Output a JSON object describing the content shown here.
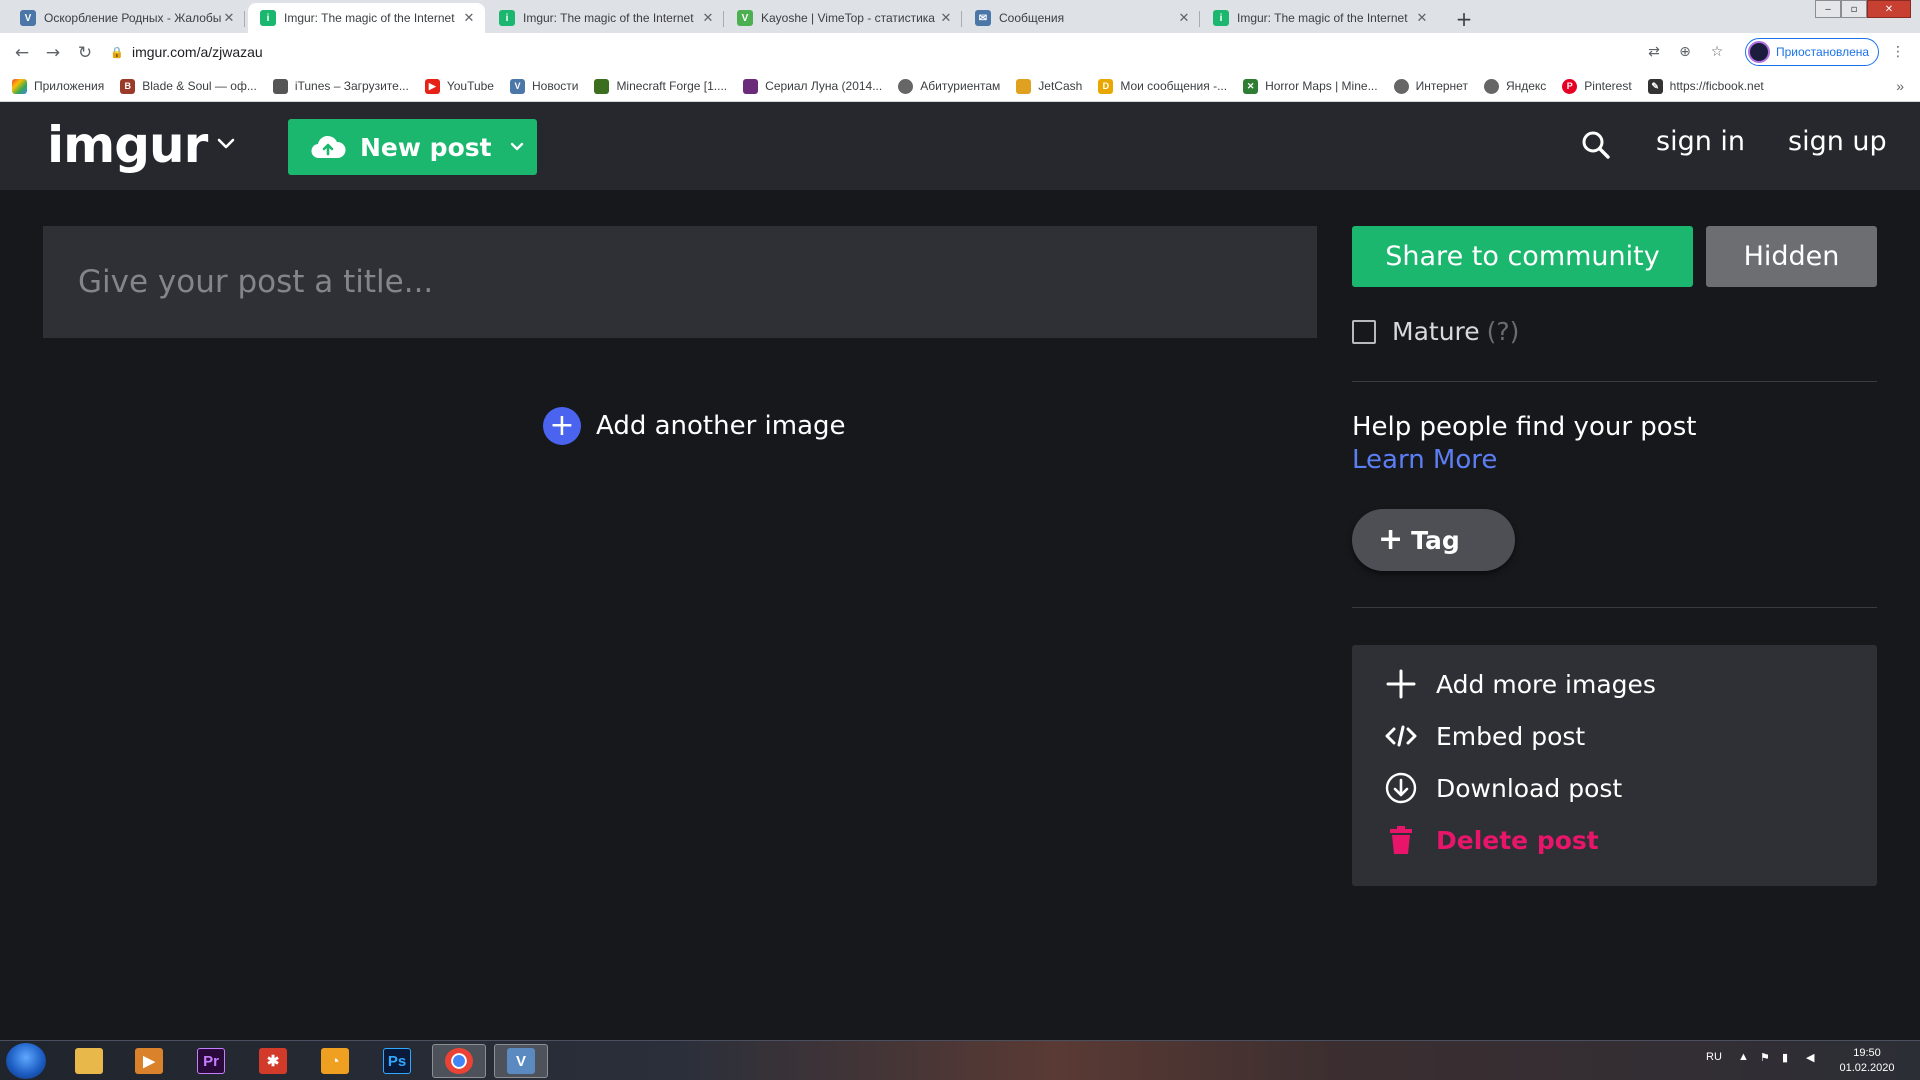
{
  "browser": {
    "tabs": [
      {
        "title": "Оскорбление Родных - Жалобы",
        "favicon": "vk"
      },
      {
        "title": "Imgur: The magic of the Internet",
        "favicon": "imgur",
        "active": true
      },
      {
        "title": "Imgur: The magic of the Internet",
        "favicon": "imgur"
      },
      {
        "title": "Kayoshe | VimeTop - статистика",
        "favicon": "vimetop"
      },
      {
        "title": "Сообщения",
        "favicon": "messages"
      },
      {
        "title": "Imgur: The magic of the Internet",
        "favicon": "imgur"
      }
    ],
    "url": "imgur.com/a/zjwazau",
    "profile_label": "Приостановлена",
    "bookmarks": [
      {
        "label": "Приложения",
        "icon": "apps-grid-icon"
      },
      {
        "label": "Blade & Soul — оф...",
        "icon": "bns-icon"
      },
      {
        "label": "iTunes – Загрузите...",
        "icon": "apple-icon"
      },
      {
        "label": "YouTube",
        "icon": "youtube-icon"
      },
      {
        "label": "Новости",
        "icon": "vk-icon"
      },
      {
        "label": "Minecraft Forge [1....",
        "icon": "minecraft-icon"
      },
      {
        "label": "Сериал Луна (2014...",
        "icon": "serial-icon"
      },
      {
        "label": "Абитуриентам",
        "icon": "globe-icon"
      },
      {
        "label": "JetCash",
        "icon": "jetcash-icon"
      },
      {
        "label": "Мои сообщения -...",
        "icon": "d-icon"
      },
      {
        "label": "Horror Maps | Mine...",
        "icon": "horror-icon"
      },
      {
        "label": "Интернет",
        "icon": "globe-icon"
      },
      {
        "label": "Яндекс",
        "icon": "globe-icon"
      },
      {
        "label": "Pinterest",
        "icon": "pinterest-icon"
      },
      {
        "label": "https://ficbook.net",
        "icon": "ficbook-icon"
      }
    ]
  },
  "header": {
    "logo": "imgur",
    "new_post_label": "New post",
    "sign_in": "sign in",
    "sign_up": "sign up"
  },
  "editor": {
    "title_placeholder": "Give your post a title...",
    "add_another_label": "Add another image"
  },
  "sidebar": {
    "share_label": "Share to community",
    "hidden_label": "Hidden",
    "mature_label": "Mature",
    "mature_help": "(?)",
    "help_title": "Help people find your post",
    "learn_more": "Learn More",
    "tag_label": "Tag",
    "actions": {
      "add_more": "Add more images",
      "embed": "Embed post",
      "download": "Download post",
      "delete": "Delete post"
    }
  },
  "taskbar": {
    "lang": "RU",
    "time": "19:50",
    "date": "01.02.2020"
  },
  "colors": {
    "imgur_green": "#1bb76e",
    "header_bg": "#26282d",
    "page_bg": "#17181c",
    "panel_bg": "#2e3035",
    "link_blue": "#5c7ef5",
    "delete_pink": "#e8156b",
    "add_blue": "#4a64f0"
  }
}
